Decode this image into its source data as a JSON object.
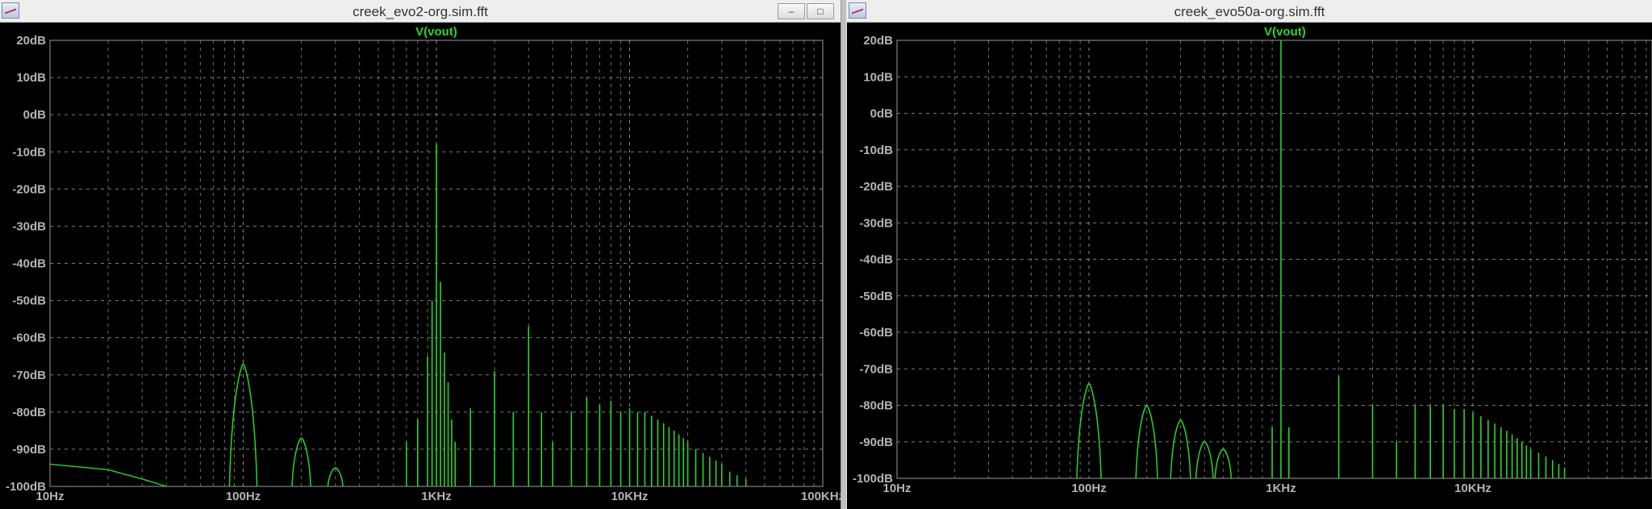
{
  "windows": [
    {
      "title": "creek_evo2-org.sim.fft",
      "trace": "V(vout)",
      "minimize_label": "‒",
      "maximize_label": "□",
      "y_ticks": [
        "20dB",
        "10dB",
        "0dB",
        "-10dB",
        "-20dB",
        "-30dB",
        "-40dB",
        "-50dB",
        "-60dB",
        "-70dB",
        "-80dB",
        "-90dB",
        "-100dB"
      ],
      "x_ticks": [
        "10Hz",
        "100Hz",
        "1KHz",
        "10KHz",
        "100KHz"
      ]
    },
    {
      "title": "creek_evo50a-org.sim.fft",
      "trace": "V(vout)",
      "y_ticks": [
        "20dB",
        "10dB",
        "0dB",
        "-10dB",
        "-20dB",
        "-30dB",
        "-40dB",
        "-50dB",
        "-60dB",
        "-70dB",
        "-80dB",
        "-90dB",
        "-100dB"
      ],
      "x_ticks": [
        "10Hz",
        "100Hz",
        "1KHz",
        "10KHz"
      ]
    }
  ],
  "chart_data": [
    {
      "type": "line",
      "trace": "V(vout)",
      "color": "#2bd42b",
      "x_scale": "log",
      "xlim": [
        10,
        100000
      ],
      "ylim": [
        -100,
        20
      ],
      "grid": true,
      "peaks_hz_db": [
        [
          100,
          -67
        ],
        [
          200,
          -87
        ],
        [
          300,
          -95
        ],
        [
          700,
          -88
        ],
        [
          800,
          -82
        ],
        [
          900,
          -65
        ],
        [
          950,
          -50
        ],
        [
          1000,
          -8
        ],
        [
          1050,
          -45
        ],
        [
          1100,
          -64
        ],
        [
          1150,
          -72
        ],
        [
          1200,
          -82
        ],
        [
          1250,
          -88
        ],
        [
          1500,
          -79
        ],
        [
          2000,
          -69
        ],
        [
          2500,
          -80
        ],
        [
          3000,
          -57
        ],
        [
          3500,
          -80
        ],
        [
          4000,
          -88
        ],
        [
          5000,
          -80
        ],
        [
          6000,
          -76
        ],
        [
          7000,
          -78
        ],
        [
          8000,
          -77
        ],
        [
          9000,
          -80
        ],
        [
          10000,
          -79
        ],
        [
          11000,
          -80
        ],
        [
          12000,
          -80
        ],
        [
          13000,
          -81
        ],
        [
          14000,
          -82
        ],
        [
          15000,
          -83
        ],
        [
          16000,
          -84
        ],
        [
          17000,
          -85
        ],
        [
          18000,
          -86
        ],
        [
          19000,
          -87
        ],
        [
          20000,
          -88
        ],
        [
          22000,
          -90
        ],
        [
          24000,
          -91
        ],
        [
          26000,
          -92
        ],
        [
          28000,
          -93
        ],
        [
          30000,
          -94
        ],
        [
          33000,
          -96
        ],
        [
          36000,
          -97
        ],
        [
          40000,
          -98
        ]
      ],
      "noise_floor": [
        [
          10,
          -94
        ],
        [
          20,
          -95.5
        ],
        [
          30,
          -98
        ],
        [
          40,
          -100
        ]
      ]
    },
    {
      "type": "line",
      "trace": "V(vout)",
      "color": "#2bd42b",
      "x_scale": "log",
      "xlim": [
        10,
        40000
      ],
      "ylim": [
        -100,
        20
      ],
      "grid": true,
      "peaks_hz_db": [
        [
          100,
          -74
        ],
        [
          200,
          -80
        ],
        [
          300,
          -84
        ],
        [
          400,
          -90
        ],
        [
          500,
          -92
        ],
        [
          900,
          -86
        ],
        [
          1000,
          20
        ],
        [
          1100,
          -86
        ],
        [
          2000,
          -72
        ],
        [
          3000,
          -80
        ],
        [
          4000,
          -90
        ],
        [
          5000,
          -80
        ],
        [
          6000,
          -80
        ],
        [
          7000,
          -80
        ],
        [
          8000,
          -81
        ],
        [
          9000,
          -81
        ],
        [
          10000,
          -82
        ],
        [
          11000,
          -83
        ],
        [
          12000,
          -84
        ],
        [
          13000,
          -85
        ],
        [
          14000,
          -86
        ],
        [
          15000,
          -87
        ],
        [
          16000,
          -88
        ],
        [
          17000,
          -89
        ],
        [
          18000,
          -90
        ],
        [
          19000,
          -91
        ],
        [
          20000,
          -92
        ],
        [
          22000,
          -93
        ],
        [
          24000,
          -94
        ],
        [
          26000,
          -95
        ],
        [
          28000,
          -96
        ],
        [
          30000,
          -97
        ]
      ]
    }
  ]
}
